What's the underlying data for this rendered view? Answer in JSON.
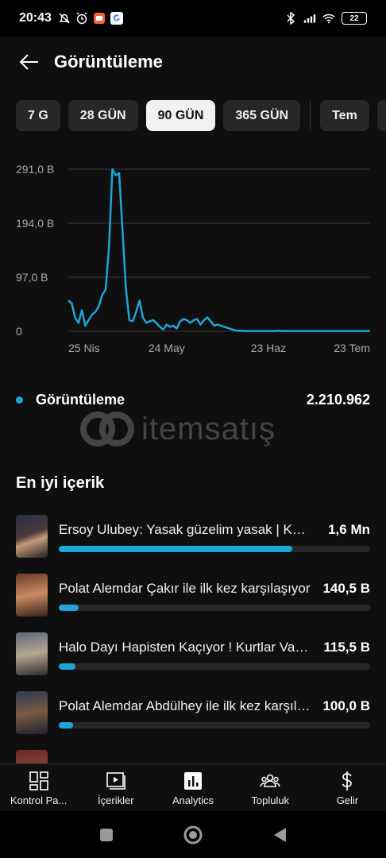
{
  "status_bar": {
    "time": "20:43",
    "battery": "22"
  },
  "header": {
    "title": "Görüntüleme"
  },
  "tabs": [
    {
      "label": "7 G",
      "active": false
    },
    {
      "label": "28 GÜN",
      "active": false
    },
    {
      "label": "90 GÜN",
      "active": true
    },
    {
      "label": "365 GÜN",
      "active": false
    },
    {
      "label": "Tem",
      "active": false
    }
  ],
  "chart_data": {
    "type": "line",
    "series": [
      {
        "values": [
          55,
          50,
          25,
          15,
          38,
          10,
          20,
          30,
          35,
          45,
          65,
          75,
          150,
          291,
          280,
          284,
          180,
          75,
          20,
          18,
          35,
          55,
          25,
          15,
          18,
          20,
          15,
          8,
          3,
          12,
          8,
          10,
          5,
          18,
          22,
          20,
          15,
          20,
          22,
          12,
          20,
          25,
          18,
          10,
          12,
          10,
          8,
          6,
          4,
          2,
          1,
          1,
          0.5,
          0.5,
          0.5,
          0.5,
          0.5,
          0.5,
          0.5,
          0.5,
          0.5,
          0.5,
          1,
          0.5,
          0.5,
          0.5,
          0.5,
          0.5,
          0.5,
          0.5,
          0.5,
          0.5,
          0.5,
          0.5,
          0.5,
          0.5,
          0.5,
          0.5,
          0.5,
          0.5,
          0.5,
          0.5,
          0.5,
          0.5,
          0.5,
          0.5,
          0.5,
          0.5,
          0.5,
          0.5
        ]
      }
    ],
    "x_tick_labels": [
      "25 Nis",
      "24 May",
      "23 Haz",
      "23 Tem"
    ],
    "x_tick_index": [
      0,
      29,
      59,
      89
    ],
    "y_tick_labels": [
      "291,0 B",
      "194,0 B",
      "97,0 B",
      "0"
    ],
    "y_tick_values": [
      291,
      194,
      97,
      0
    ],
    "ylim": [
      0,
      291
    ],
    "grid": true,
    "series_color": "#1ea5d6"
  },
  "summary": {
    "label": "Görüntüleme",
    "value": "2.210.962"
  },
  "watermark": {
    "text": "itemsatış"
  },
  "top_content": {
    "title": "En iyi içerik",
    "items": [
      {
        "title": "Ersoy Ulubey: Yasak güzelim yasak | Kurtlar Vadisi",
        "value": "1,6 Mn",
        "share": 0.75
      },
      {
        "title": "Polat Alemdar Çakır ile ilk kez karşılaşıyor",
        "value": "140,5 B",
        "share": 0.065
      },
      {
        "title": "Halo Dayı Hapisten Kaçıyor ! Kurtlar Vadisi",
        "value": "115,5 B",
        "share": 0.053
      },
      {
        "title": "Polat Alemdar Abdülhey ile ilk kez karşılaşıyor",
        "value": "100,0 B",
        "share": 0.046
      }
    ]
  },
  "bottom_nav": [
    {
      "label": "Kontrol Pa...",
      "icon": "dashboard-icon"
    },
    {
      "label": "İçerikler",
      "icon": "content-icon"
    },
    {
      "label": "Analytics",
      "icon": "analytics-icon"
    },
    {
      "label": "Topluluk",
      "icon": "community-icon"
    },
    {
      "label": "Gelir",
      "icon": "earn-icon"
    }
  ]
}
